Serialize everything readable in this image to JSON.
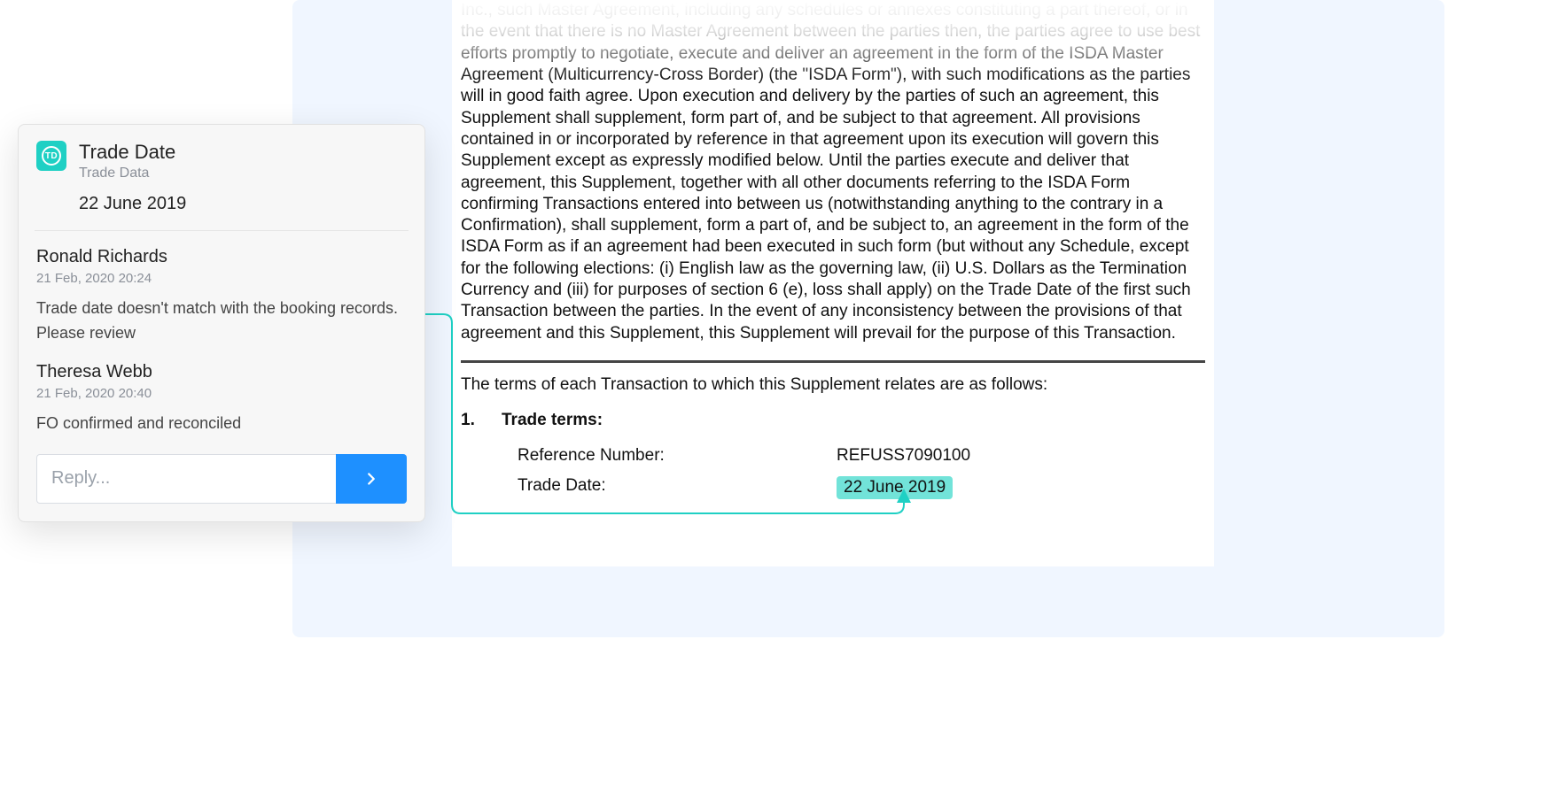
{
  "card": {
    "badge": "TD",
    "title": "Trade Date",
    "subtitle": "Trade Data",
    "value": "22 June 2019",
    "comments": [
      {
        "author": "Ronald Richards",
        "when": "21 Feb, 2020  20:24",
        "body": "Trade date doesn't match with the booking records. Please review"
      },
      {
        "author": "Theresa Webb",
        "when": "21 Feb, 2020  20:40",
        "body": "FO confirmed and reconciled"
      }
    ],
    "reply_placeholder": "Reply..."
  },
  "document": {
    "paragraph": "Inc., such Master Agreement, including any schedules or annexes constituting a part thereof, or in the event that there is no Master Agreement between the parties then, the parties agree to use best efforts promptly to negotiate, execute and deliver an agreement in the form of the ISDA Master Agreement (Multicurrency-Cross Border) (the \"ISDA Form\"), with such modifications as the parties will in good faith agree. Upon execution and delivery by the parties of such an agreement, this Supplement shall supplement, form part of, and be subject to that agreement. All provisions contained in or incorporated by reference in that agreement upon its execution will govern this Supplement except as expressly modified below. Until the parties execute and deliver that agreement, this Supplement, together with all other documents referring to the ISDA Form confirming Transactions entered into between us (notwithstanding anything to the contrary in a Confirmation), shall supplement, form a part of, and be subject to, an agreement in the form of the ISDA Form as if an agreement had been executed in such form (but without any Schedule, except for the following elections: (i) English law as the governing law, (ii) U.S. Dollars as the Termination Currency and (iii) for purposes of section 6 (e), loss shall apply) on the Trade Date of the first such Transaction between the parties. In the event of any inconsistency between the provisions of that agreement and this Supplement, this Supplement will prevail for the purpose of this Transaction.",
    "terms_intro": "The terms of each Transaction to which this Supplement relates are as follows:",
    "section_num": "1.",
    "section_heading": "Trade terms:",
    "rows": [
      {
        "label": "Reference Number:",
        "value": "REFUSS7090100"
      },
      {
        "label": "Trade Date:",
        "value": "22 June 2019"
      }
    ]
  }
}
